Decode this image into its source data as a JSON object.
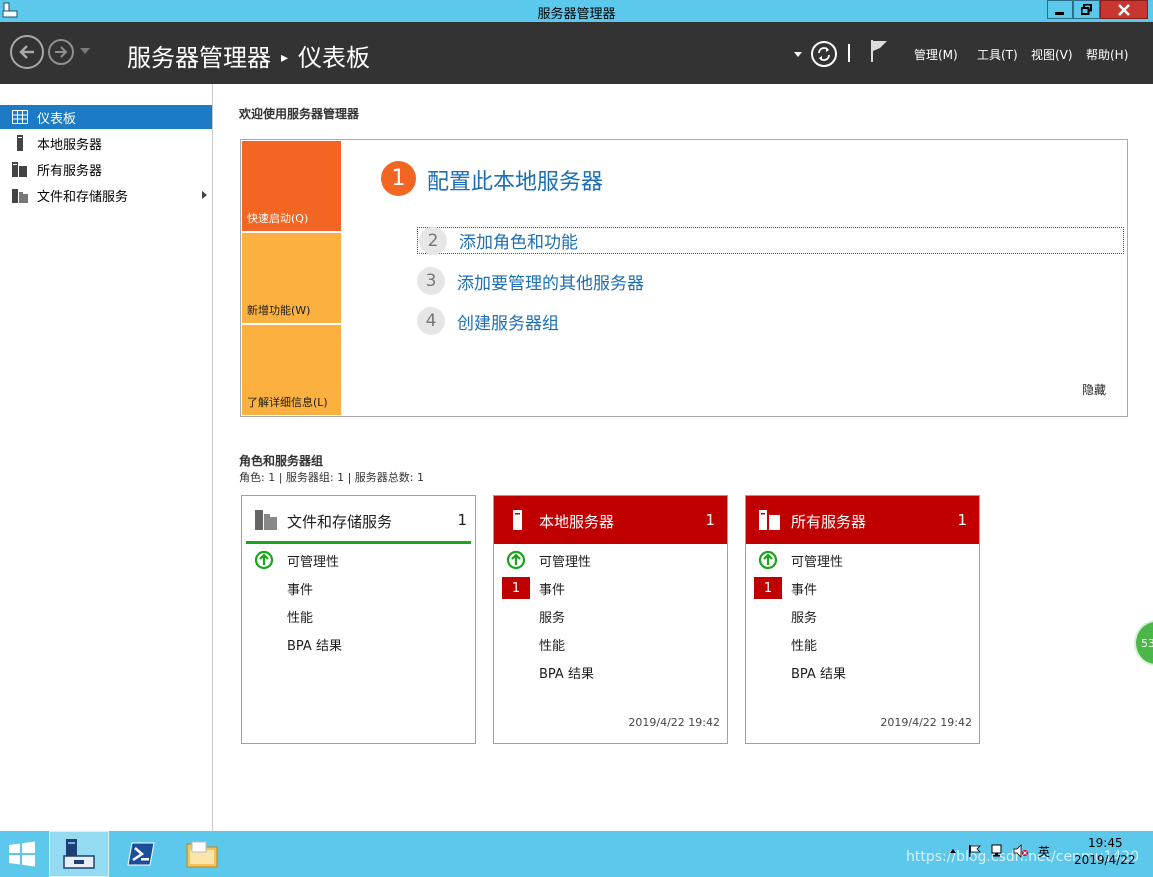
{
  "window": {
    "title": "服务器管理器"
  },
  "header": {
    "breadcrumb": {
      "root": "服务器管理器",
      "current": "仪表板"
    },
    "menus": {
      "manage": "管理(M)",
      "tools": "工具(T)",
      "view": "视图(V)",
      "help": "帮助(H)"
    }
  },
  "sidebar": {
    "items": [
      {
        "label": "仪表板",
        "icon": "dashboard-icon",
        "active": true
      },
      {
        "label": "本地服务器",
        "icon": "server-icon"
      },
      {
        "label": "所有服务器",
        "icon": "servers-icon"
      },
      {
        "label": "文件和存储服务",
        "icon": "file-storage-icon"
      }
    ]
  },
  "welcome": {
    "title": "欢迎使用服务器管理器",
    "tiles": {
      "quick_start": "快速启动(Q)",
      "whats_new": "新增功能(W)",
      "learn_more": "了解详细信息(L)"
    },
    "steps": [
      {
        "num": "1",
        "label": "配置此本地服务器"
      },
      {
        "num": "2",
        "label": "添加角色和功能"
      },
      {
        "num": "3",
        "label": "添加要管理的其他服务器"
      },
      {
        "num": "4",
        "label": "创建服务器组"
      }
    ],
    "hide": "隐藏"
  },
  "roles": {
    "title": "角色和服务器组",
    "summary": "角色: 1 | 服务器组: 1 | 服务器总数: 1",
    "cards": [
      {
        "title": "文件和存储服务",
        "count": "1",
        "rows": {
          "manageability": "可管理性",
          "events": "事件",
          "performance": "性能",
          "bpa": "BPA 结果"
        }
      },
      {
        "title": "本地服务器",
        "count": "1",
        "rows": {
          "manageability": "可管理性",
          "events": "事件",
          "events_badge": "1",
          "services": "服务",
          "performance": "性能",
          "bpa": "BPA 结果"
        },
        "timestamp": "2019/4/22 19:42"
      },
      {
        "title": "所有服务器",
        "count": "1",
        "rows": {
          "manageability": "可管理性",
          "events": "事件",
          "events_badge": "1",
          "services": "服务",
          "performance": "性能",
          "bpa": "BPA 结果"
        },
        "timestamp": "2019/4/22 19:42"
      }
    ]
  },
  "side_bubble": "53",
  "taskbar": {
    "clock_time": "19:45",
    "clock_date": "2019/4/22",
    "ime": "英",
    "watermark": "https://blog.csdn.net/cenmu1420"
  },
  "colors": {
    "accent_blue": "#1c7bc4",
    "link_blue": "#1c6fb5",
    "tile_orange": "#f26522",
    "tile_amber": "#fbb040",
    "alert_red": "#c00000",
    "ok_green": "#1aa51a",
    "header_dark": "#333333",
    "chrome_cyan": "#5bc8ec"
  }
}
